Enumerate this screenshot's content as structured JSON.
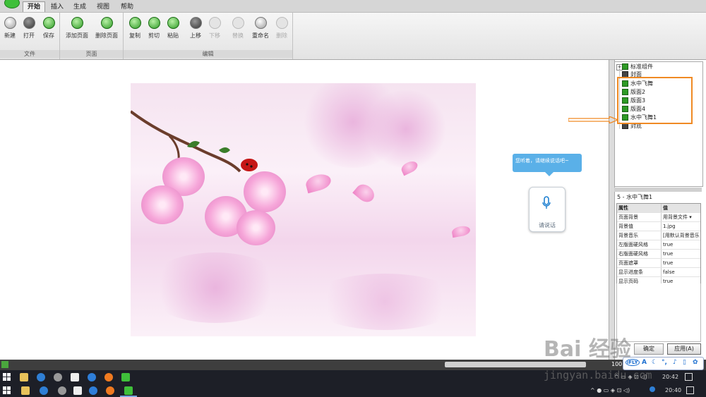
{
  "ribbon": {
    "tabs": [
      "开始",
      "插入",
      "生成",
      "视图",
      "帮助"
    ],
    "groups": [
      {
        "label": "文件",
        "buttons": [
          "新建",
          "打开",
          "保存"
        ]
      },
      {
        "label": "页面",
        "buttons": [
          "添加页面",
          "删除页面"
        ]
      },
      {
        "label": "编辑",
        "buttons": [
          "复制",
          "剪切",
          "粘贴",
          "上移",
          "下移",
          "替换",
          "重命名",
          "删除"
        ]
      }
    ]
  },
  "voice": {
    "tip": "您听着，请继续说话吧~",
    "label": "请说话"
  },
  "tree": {
    "items": [
      "标准组件",
      "封面",
      "水中飞舞",
      "版面2",
      "版面3",
      "版面4",
      "水中飞舞1",
      "封底"
    ]
  },
  "properties": {
    "title": "5 - 水中飞舞1",
    "header": {
      "key": "属性",
      "value": "值"
    },
    "rows": [
      {
        "key": "页面背景",
        "value": "用背景文件"
      },
      {
        "key": "背景值",
        "value": "1.jpg"
      },
      {
        "key": "背景音乐",
        "value": "[用默认背景音乐"
      },
      {
        "key": "左版面硬风格",
        "value": "true"
      },
      {
        "key": "右版面硬风格",
        "value": "true"
      },
      {
        "key": "页面遮罩",
        "value": "true"
      },
      {
        "key": "显示进度条",
        "value": "false"
      },
      {
        "key": "显示页码",
        "value": "true"
      }
    ],
    "confirm": "确定",
    "apply": "应用(A)"
  },
  "status": {
    "zoom": "100"
  },
  "ime": {
    "logo": "iFLY",
    "a": "A"
  },
  "taskbar1": {
    "time": "20:42"
  },
  "taskbar2": {
    "time": "20:40"
  },
  "watermark": {
    "brand": "Bai 经验",
    "url": "jingyan.baidu.com"
  },
  "colors": {
    "highlight": "#f08a24",
    "accent": "#2e9a25",
    "voice": "#5ab0e8"
  }
}
